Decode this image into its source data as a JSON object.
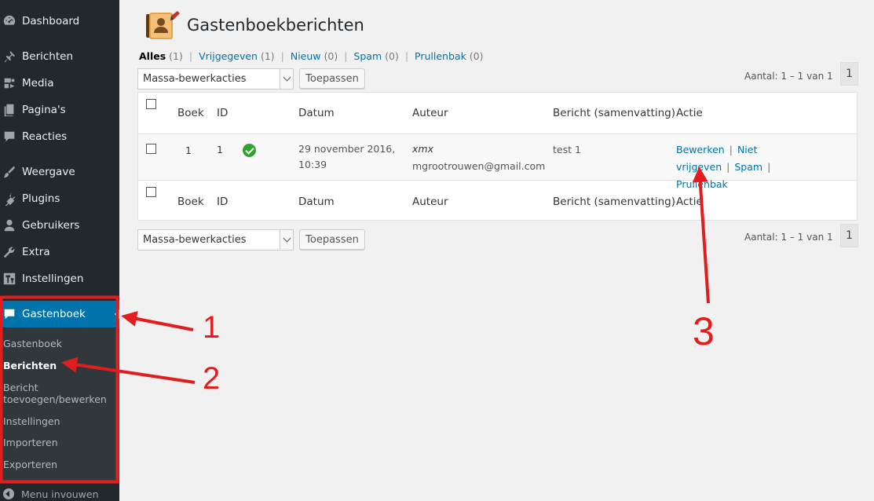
{
  "sidebar": {
    "items": [
      {
        "label": "Dashboard",
        "icon": "dashboard-icon"
      },
      {
        "label": "Berichten",
        "icon": "pin-icon"
      },
      {
        "label": "Media",
        "icon": "media-icon"
      },
      {
        "label": "Pagina's",
        "icon": "page-icon"
      },
      {
        "label": "Reacties",
        "icon": "comment-icon"
      },
      {
        "label": "Weergave",
        "icon": "brush-icon"
      },
      {
        "label": "Plugins",
        "icon": "plug-icon"
      },
      {
        "label": "Gebruikers",
        "icon": "user-icon"
      },
      {
        "label": "Extra",
        "icon": "wrench-icon"
      },
      {
        "label": "Instellingen",
        "icon": "settings-icon"
      },
      {
        "label": "Gastenboek",
        "icon": "speech-bubble-icon",
        "active": true
      }
    ],
    "submenu": [
      {
        "label": "Gastenboek"
      },
      {
        "label": "Berichten",
        "current": true
      },
      {
        "label": "Bericht toevoegen/bewerken"
      },
      {
        "label": "Instellingen"
      },
      {
        "label": "Importeren"
      },
      {
        "label": "Exporteren"
      }
    ],
    "collapse_label": "Menu invouwen"
  },
  "page": {
    "title": "Gastenboekberichten",
    "filters": [
      {
        "label": "Alles",
        "count": "(1)",
        "current": true
      },
      {
        "label": "Vrijgegeven",
        "count": "(1)"
      },
      {
        "label": "Nieuw",
        "count": "(0)"
      },
      {
        "label": "Spam",
        "count": "(0)"
      },
      {
        "label": "Prullenbak",
        "count": "(0)"
      }
    ],
    "bulk_action": "Massa-bewerkacties",
    "apply_label": "Toepassen",
    "count_text": "Aantal: 1 – 1 van 1",
    "page_number": "1"
  },
  "table": {
    "columns": [
      "Boek",
      "ID",
      "Datum",
      "Auteur",
      "Bericht (samenvatting)",
      "Actie"
    ],
    "rows": [
      {
        "book": "1",
        "id": "1",
        "date_line1": "29 november 2016,",
        "date_line2": "10:39",
        "author_name": "xmx",
        "author_email": "mgrootrouwen@gmail.com",
        "excerpt": "test 1",
        "actions": [
          "Bewerken",
          "Niet vrijgeven",
          "Spam",
          "Prullenbak"
        ]
      }
    ]
  },
  "annotations": {
    "labels": [
      "1",
      "2",
      "3"
    ],
    "color": "#e21d1d"
  }
}
